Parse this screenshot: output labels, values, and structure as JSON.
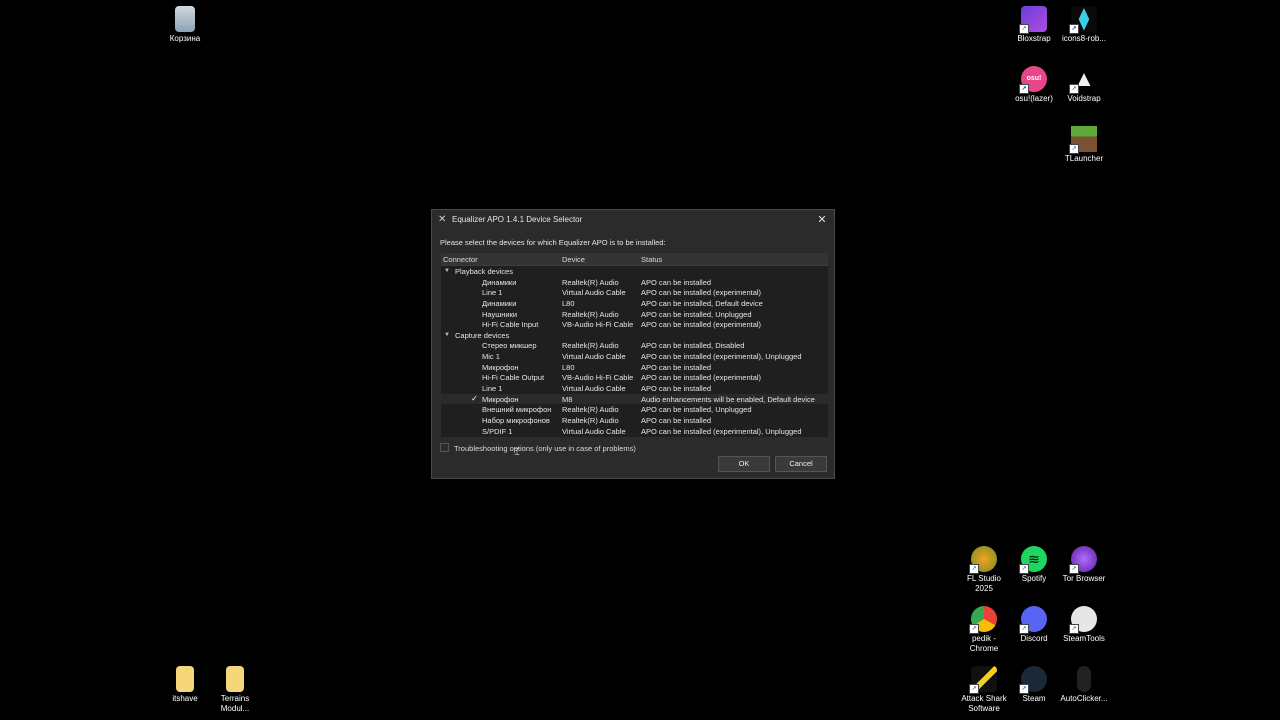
{
  "desktop": {
    "icons": [
      {
        "label": "Корзина"
      },
      {
        "label": "Bloxstrap"
      },
      {
        "label": "icons8-rob..."
      },
      {
        "label": "osu!(lazer)"
      },
      {
        "label": "Voidstrap"
      },
      {
        "label": "TLauncher"
      },
      {
        "label": "FL Studio 2025"
      },
      {
        "label": "Spotify"
      },
      {
        "label": "Tor Browser"
      },
      {
        "label": "pedik - Chrome"
      },
      {
        "label": "Discord"
      },
      {
        "label": "SteamTools"
      },
      {
        "label": "itshave"
      },
      {
        "label": "Terrains Modul..."
      },
      {
        "label": "Attack Shark Software"
      },
      {
        "label": "Steam"
      },
      {
        "label": "AutoClicker..."
      }
    ]
  },
  "dialog": {
    "title": "Equalizer APO 1.4.1 Device Selector",
    "prompt": "Please select the devices for which Equalizer APO is to be installed:",
    "columns": {
      "connector": "Connector",
      "device": "Device",
      "status": "Status"
    },
    "groups": {
      "playback": "Playback devices",
      "capture": "Capture devices"
    },
    "playback": [
      {
        "connector": "Динамики",
        "device": "Realtek(R) Audio",
        "status": "APO can be installed"
      },
      {
        "connector": "Line 1",
        "device": "Virtual Audio Cable",
        "status": "APO can be installed (experimental)"
      },
      {
        "connector": "Динамики",
        "device": "L80",
        "status": "APO can be installed, Default device"
      },
      {
        "connector": "Наушники",
        "device": "Realtek(R) Audio",
        "status": "APO can be installed, Unplugged"
      },
      {
        "connector": "Hi-Fi Cable Input",
        "device": "VB-Audio Hi-Fi Cable",
        "status": "APO can be installed (experimental)"
      }
    ],
    "capture": [
      {
        "connector": "Стерео микшер",
        "device": "Realtek(R) Audio",
        "status": "APO can be installed, Disabled"
      },
      {
        "connector": "Mic 1",
        "device": "Virtual Audio Cable",
        "status": "APO can be installed (experimental), Unplugged"
      },
      {
        "connector": "Микрофон",
        "device": "L80",
        "status": "APO can be installed"
      },
      {
        "connector": "Hi-Fi Cable Output",
        "device": "VB-Audio Hi-Fi Cable",
        "status": "APO can be installed (experimental)"
      },
      {
        "connector": "Line 1",
        "device": "Virtual Audio Cable",
        "status": "APO can be installed"
      },
      {
        "connector": "Микрофон",
        "device": "M8",
        "status": "Audio enhancements will be enabled, Default device",
        "checked": "✓"
      },
      {
        "connector": "Внешний микрофон",
        "device": "Realtek(R) Audio",
        "status": "APO can be installed, Unplugged"
      },
      {
        "connector": "Набор микрофонов",
        "device": "Realtek(R) Audio",
        "status": "APO can be installed"
      },
      {
        "connector": "S/PDIF 1",
        "device": "Virtual Audio Cable",
        "status": "APO can be installed (experimental), Unplugged"
      }
    ],
    "troubleshooting": "Troubleshooting options (only use in case of problems)",
    "ok": "OK",
    "cancel": "Cancel"
  }
}
